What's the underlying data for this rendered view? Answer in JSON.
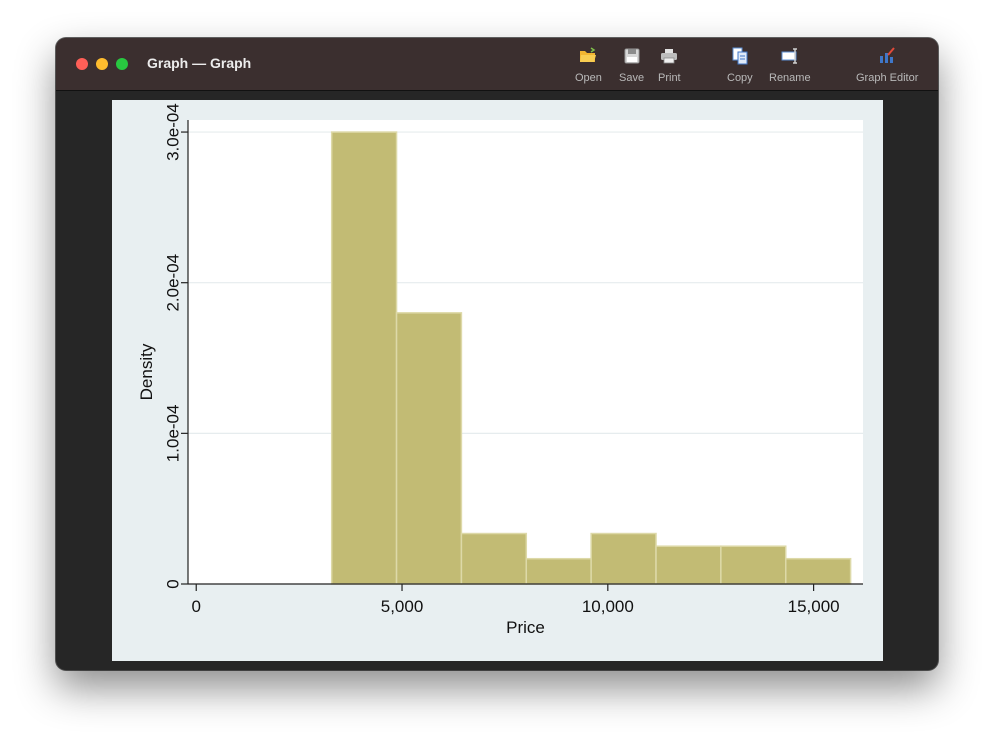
{
  "window": {
    "title": "Graph — Graph"
  },
  "toolbar": {
    "items": [
      {
        "label": "Open",
        "icon": "folder-open-icon"
      },
      {
        "label": "Save",
        "icon": "floppy-disk-icon"
      },
      {
        "label": "Print",
        "icon": "printer-icon"
      },
      {
        "label": "Copy",
        "icon": "copy-icon"
      },
      {
        "label": "Rename",
        "icon": "rename-icon"
      },
      {
        "label": "Graph Editor",
        "icon": "graph-editor-icon"
      }
    ]
  },
  "colors": {
    "bar_fill": "#c2bb74",
    "bar_edge": "#ddd9a8",
    "plot_bg": "#ffffff",
    "graph_bg": "#e8eff1",
    "grid": "#e6ecee"
  },
  "chart_data": {
    "type": "bar",
    "xlabel": "Price",
    "ylabel": "Density",
    "xlim": [
      -200,
      16200
    ],
    "ylim": [
      0,
      0.000308
    ],
    "xticks": [
      {
        "value": 0,
        "label": "0"
      },
      {
        "value": 5000,
        "label": "5,000"
      },
      {
        "value": 10000,
        "label": "10,000"
      },
      {
        "value": 15000,
        "label": "15,000"
      }
    ],
    "yticks": [
      {
        "value": 0,
        "label": "0"
      },
      {
        "value": 0.0001,
        "label": "1.0e-04"
      },
      {
        "value": 0.0002,
        "label": "2.0e-04"
      },
      {
        "value": 0.0003,
        "label": "3.0e-04"
      }
    ],
    "grid": true,
    "bins": [
      {
        "start": 3291,
        "end": 4867,
        "density": 0.0003
      },
      {
        "start": 4867,
        "end": 6443,
        "density": 0.00018
      },
      {
        "start": 6443,
        "end": 8019,
        "density": 3.35e-05
      },
      {
        "start": 8019,
        "end": 9595,
        "density": 1.68e-05
      },
      {
        "start": 9595,
        "end": 11171,
        "density": 3.35e-05
      },
      {
        "start": 11171,
        "end": 12747,
        "density": 2.51e-05
      },
      {
        "start": 12747,
        "end": 14323,
        "density": 2.51e-05
      },
      {
        "start": 14323,
        "end": 15899,
        "density": 1.68e-05
      }
    ]
  }
}
